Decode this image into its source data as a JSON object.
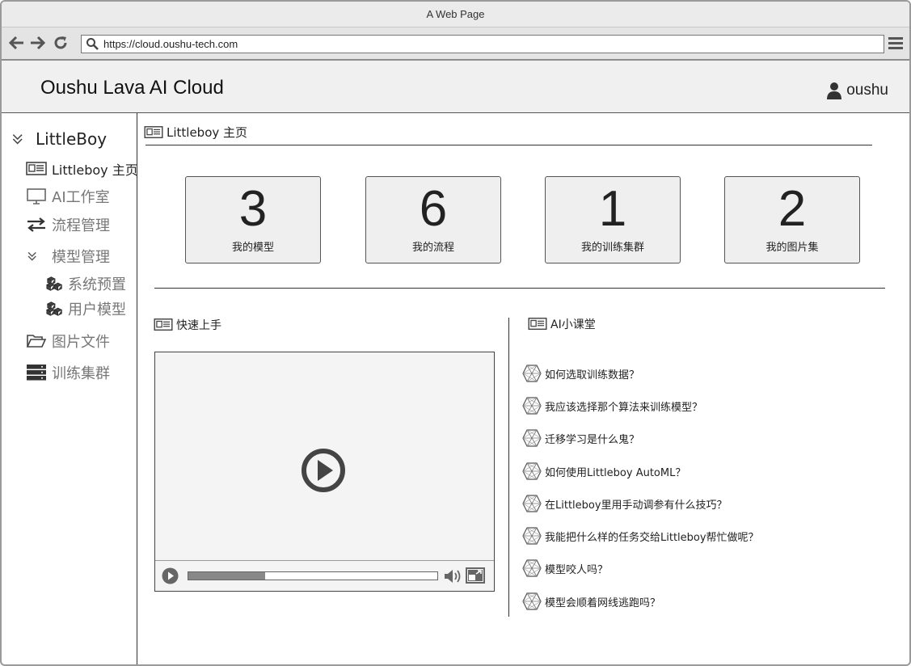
{
  "browser": {
    "window_title": "A Web Page",
    "url": "https://cloud.oushu-tech.com"
  },
  "header": {
    "app_title": "Oushu Lava AI Cloud",
    "username": "oushu"
  },
  "sidebar": {
    "root_label": "LittleBoy",
    "items": [
      {
        "label": "Littleboy 主页",
        "icon": "newspaper-icon"
      },
      {
        "label": "AI工作室",
        "icon": "monitor-icon"
      },
      {
        "label": "流程管理",
        "icon": "exchange-icon"
      },
      {
        "label": "模型管理",
        "icon": "chevron-double-down-icon"
      },
      {
        "label": "系统预置",
        "icon": "cubes-icon"
      },
      {
        "label": "用户模型",
        "icon": "cubes-icon"
      },
      {
        "label": "图片文件",
        "icon": "folder-open-icon"
      },
      {
        "label": "训练集群",
        "icon": "server-icon"
      }
    ]
  },
  "main": {
    "page_heading": "Littleboy 主页",
    "stats": [
      {
        "value": "3",
        "label": "我的模型"
      },
      {
        "value": "6",
        "label": "我的流程"
      },
      {
        "value": "1",
        "label": "我的训练集群"
      },
      {
        "value": "2",
        "label": "我的图片集"
      }
    ],
    "quickstart": {
      "title": "快速上手",
      "video_progress": 0.31
    },
    "classroom": {
      "title": "AI小课堂",
      "questions": [
        "如何选取训练数据？",
        "我应该选择那个算法来训练模型？",
        "迁移学习是什么鬼？",
        "如何使用Littleboy AutoML？",
        "在Littleboy里用手动调参有什么技巧？",
        "我能把什么样的任务交给Littleboy帮忙做呢？",
        "模型咬人吗？",
        "模型会顺着网线逃跑吗？"
      ]
    }
  },
  "colors": {
    "icon_gray": "#555555",
    "muted_text": "#777777",
    "panel_bg": "#efefef"
  }
}
